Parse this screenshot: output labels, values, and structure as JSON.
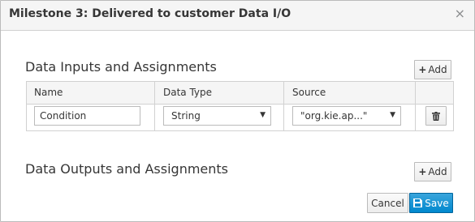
{
  "dialog": {
    "title": "Milestone 3: Delivered to customer Data I/O",
    "close_glyph": "×"
  },
  "inputs_section": {
    "title": "Data Inputs and Assignments",
    "add_label": "Add",
    "columns": [
      "Name",
      "Data Type",
      "Source"
    ],
    "rows": [
      {
        "name": "Condition",
        "data_type": "String",
        "source": "\"org.kie.ap...\""
      }
    ]
  },
  "outputs_section": {
    "title": "Data Outputs and Assignments",
    "add_label": "Add"
  },
  "footer": {
    "cancel_label": "Cancel",
    "save_label": "Save"
  },
  "colors": {
    "primary": "#0088ce",
    "header_bg": "#f5f5f5",
    "border": "#bbbbbb"
  }
}
